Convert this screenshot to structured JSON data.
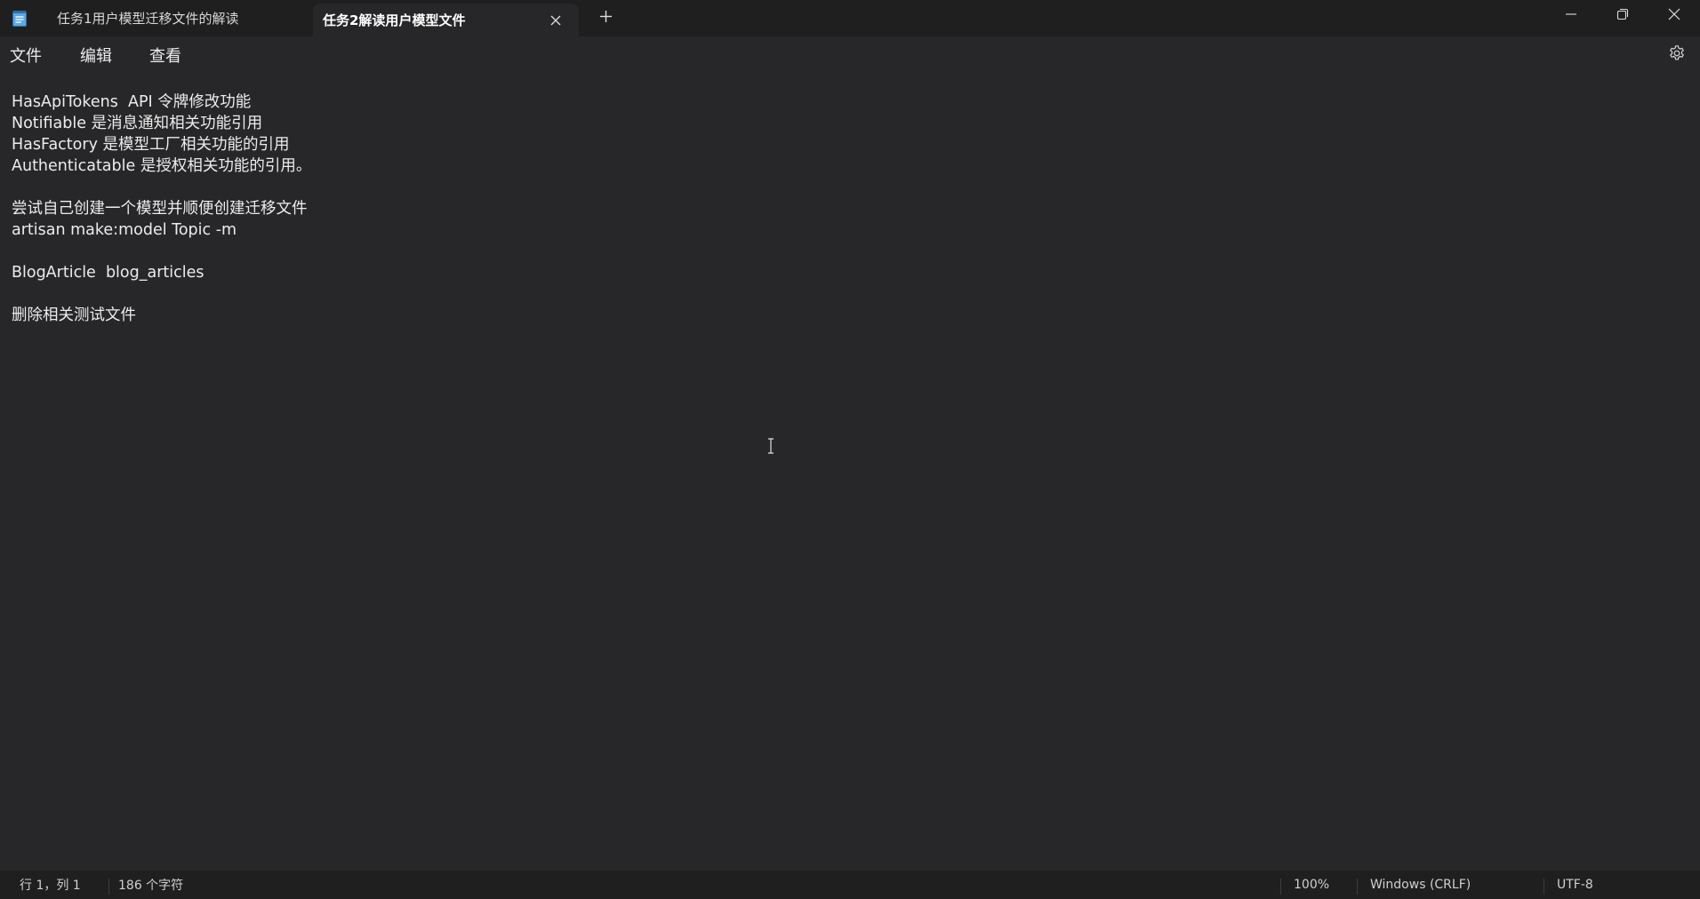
{
  "tabs": [
    {
      "title": "任务1用户模型迁移文件的解读",
      "active": false
    },
    {
      "title": "任务2解读用户模型文件",
      "active": true
    }
  ],
  "menu": {
    "file": "文件",
    "edit": "编辑",
    "view": "查看"
  },
  "icons": {
    "app": "notepad-icon",
    "close_tab": "close-icon",
    "new_tab": "plus-icon",
    "minimize": "minimize-icon",
    "restore": "restore-icon",
    "close_window": "close-icon",
    "settings": "gear-icon",
    "cursor": "text-cursor-icon"
  },
  "editor": {
    "content": "HasApiTokens  API 令牌修改功能\nNotifiable 是消息通知相关功能引用\nHasFactory 是模型工厂相关功能的引用\nAuthenticatable 是授权相关功能的引用。\n\n尝试自己创建一个模型并顺便创建迁移文件\nartisan make:model Topic -m\n\nBlogArticle  blog_articles\n\n删除相关测试文件"
  },
  "status": {
    "position": "行 1，列 1",
    "char_count": "186 个字符",
    "zoom": "100%",
    "line_ending": "Windows (CRLF)",
    "encoding": "UTF-8"
  },
  "colors": {
    "background": "#272729",
    "chrome": "#1f1f1f",
    "text": "#ececec"
  }
}
